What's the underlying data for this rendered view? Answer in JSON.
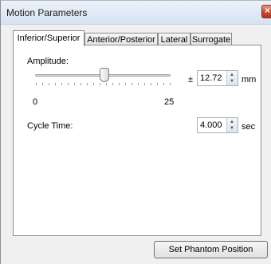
{
  "window": {
    "title": "Motion Parameters"
  },
  "tabs": [
    {
      "label": "Inferior/Superior",
      "active": true
    },
    {
      "label": "Anterior/Posterior",
      "active": false
    },
    {
      "label": "Lateral",
      "active": false
    },
    {
      "label": "Surrogate",
      "active": false
    }
  ],
  "amplitude": {
    "label": "Amplitude:",
    "prefix": "±",
    "value": "12.72",
    "unit": "mm",
    "slider_min": "0",
    "slider_max": "25",
    "slider_value": 12.72
  },
  "cycle_time": {
    "label": "Cycle Time:",
    "value": "4.000",
    "unit": "sec"
  },
  "buttons": {
    "set_phantom": "Set Phantom Position"
  },
  "icons": {
    "close": "close-icon",
    "spin_up": "arrow-up-icon",
    "spin_down": "arrow-down-icon",
    "slider_thumb": "slider-thumb"
  }
}
